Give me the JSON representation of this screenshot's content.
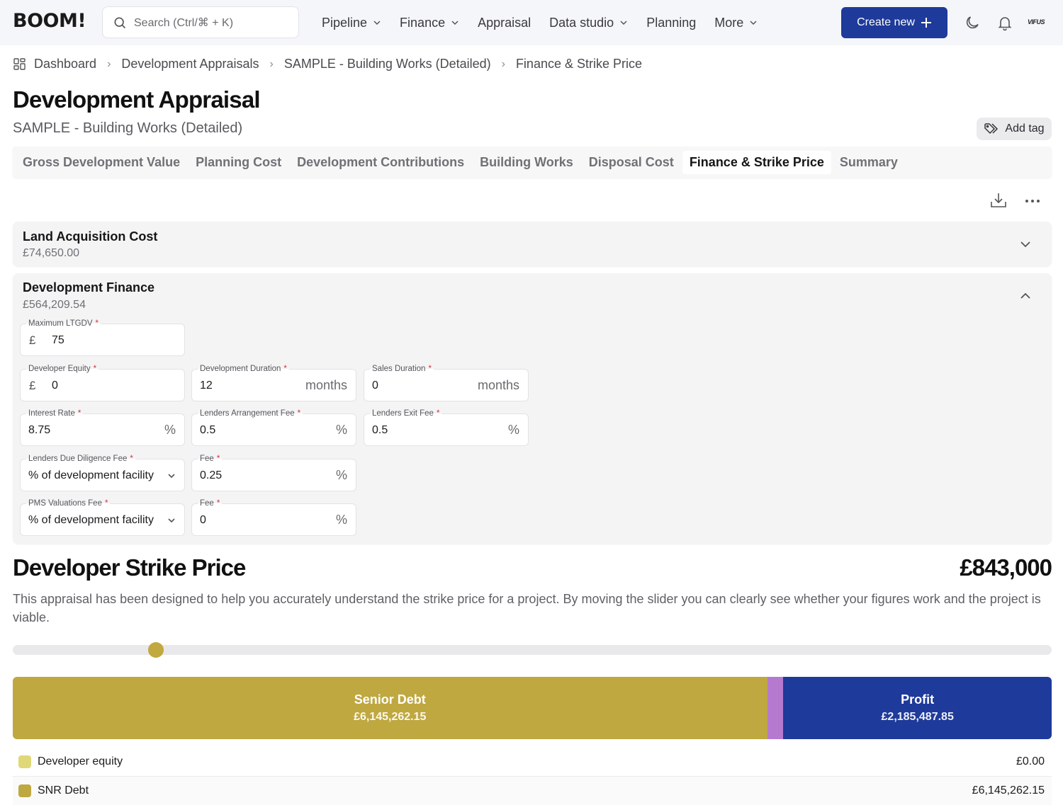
{
  "app": {
    "logo": "BOOM",
    "logo_bang": "!",
    "search_placeholder": "Search (Ctrl/⌘ + K)",
    "nav": [
      {
        "label": "Pipeline",
        "dropdown": true
      },
      {
        "label": "Finance",
        "dropdown": true
      },
      {
        "label": "Appraisal",
        "dropdown": false
      },
      {
        "label": "Data studio",
        "dropdown": true
      },
      {
        "label": "Planning",
        "dropdown": false
      },
      {
        "label": "More",
        "dropdown": true
      }
    ],
    "create_new_label": "Create new",
    "user_org_logo": "VIFUS",
    "icons": [
      "search-icon",
      "moon-icon",
      "bell-icon",
      "plus-icon",
      "chevron-down-icon"
    ]
  },
  "breadcrumb": [
    "Dashboard",
    "Development Appraisals",
    "SAMPLE - Building Works (Detailed)",
    "Finance & Strike Price"
  ],
  "page": {
    "title": "Development Appraisal",
    "subtitle": "SAMPLE - Building Works (Detailed)",
    "add_tag_label": "Add tag"
  },
  "tabs": [
    {
      "label": "Gross Development Value",
      "active": false
    },
    {
      "label": "Planning Cost",
      "active": false
    },
    {
      "label": "Development Contributions",
      "active": false
    },
    {
      "label": "Building Works",
      "active": false
    },
    {
      "label": "Disposal Cost",
      "active": false
    },
    {
      "label": "Finance & Strike Price",
      "active": true
    },
    {
      "label": "Summary",
      "active": false
    }
  ],
  "sections": {
    "land": {
      "title": "Land Acquisition Cost",
      "amount": "£74,650.00",
      "expanded": false
    },
    "finance": {
      "title": "Development Finance",
      "amount": "£564,209.54",
      "expanded": true,
      "fields": {
        "max_ltgdv": {
          "label": "Maximum LTGDV",
          "required": true,
          "prefix": "£",
          "value": "75"
        },
        "developer_equity": {
          "label": "Developer Equity",
          "required": true,
          "prefix": "£",
          "value": "0"
        },
        "development_duration": {
          "label": "Development Duration",
          "required": true,
          "value": "12",
          "suffix": "months"
        },
        "sales_duration": {
          "label": "Sales Duration",
          "required": true,
          "value": "0",
          "suffix": "months"
        },
        "interest_rate": {
          "label": "Interest Rate",
          "required": true,
          "value": "8.75",
          "suffix": "%"
        },
        "arrangement_fee": {
          "label": "Lenders Arrangement Fee",
          "required": true,
          "value": "0.5",
          "suffix": "%"
        },
        "exit_fee": {
          "label": "Lenders Exit Fee",
          "required": true,
          "value": "0.5",
          "suffix": "%"
        },
        "due_diligence_type": {
          "label": "Lenders Due Diligence Fee",
          "required": true,
          "value": "% of development facility"
        },
        "due_diligence_fee": {
          "label": "Fee",
          "required": true,
          "value": "0.25",
          "suffix": "%"
        },
        "pms_type": {
          "label": "PMS Valuations Fee",
          "required": true,
          "value": "% of development facility"
        },
        "pms_fee": {
          "label": "Fee",
          "required": true,
          "value": "0",
          "suffix": "%"
        }
      }
    }
  },
  "strike": {
    "title": "Developer Strike Price",
    "price": "£843,000",
    "description": "This appraisal has been designed to help you accurately understand the strike price for a project. By moving the slider you can clearly see whether your figures work and the project is viable.",
    "slider_fraction": 0.138
  },
  "chart_data": {
    "type": "bar",
    "orientation": "horizontal-stacked",
    "title": "",
    "series": [
      {
        "name": "Senior Debt",
        "value": 6145262.15,
        "label": "£6,145,262.15",
        "color": "#bfa840",
        "show_label": true
      },
      {
        "name": "",
        "value": 132000,
        "label": "",
        "color": "#b57ad0",
        "show_label": false
      },
      {
        "name": "Profit",
        "value": 2185487.85,
        "label": "£2,185,487.85",
        "color": "#1e3a9a",
        "show_label": true
      }
    ]
  },
  "legend": [
    {
      "label": "Developer equity",
      "amount": "£0.00",
      "color": "#e0d878"
    },
    {
      "label": "SNR Debt",
      "amount": "£6,145,262.15",
      "color": "#bfa840"
    }
  ]
}
